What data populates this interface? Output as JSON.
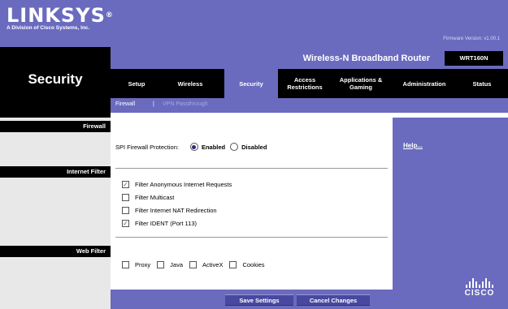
{
  "header": {
    "logo": "LINKSYS",
    "logo_mark": "®",
    "logo_sub": "A Division of Cisco Systems, Inc.",
    "firmware": "Firmware Version: v1.00.1"
  },
  "page_title": "Security",
  "product": {
    "name": "Wireless-N Broadband Router",
    "model": "WRT160N"
  },
  "nav": {
    "tabs": [
      {
        "label": "Setup"
      },
      {
        "label": "Wireless"
      },
      {
        "label": "Security",
        "active": true
      },
      {
        "label": "Access\nRestrictions"
      },
      {
        "label": "Applications &\nGaming"
      },
      {
        "label": "Administration"
      },
      {
        "label": "Status"
      }
    ],
    "subtabs": [
      {
        "label": "Firewall",
        "active": true
      },
      {
        "label": "|"
      },
      {
        "label": "VPN Passthrough"
      }
    ]
  },
  "sections": {
    "firewall": "Firewall",
    "internet_filter": "Internet Filter",
    "web_filter": "Web Filter"
  },
  "firewall": {
    "label": "SPI Firewall Protection:",
    "options": [
      {
        "label": "Enabled",
        "selected": true
      },
      {
        "label": "Disabled",
        "selected": false
      }
    ]
  },
  "internet_filter": {
    "items": [
      {
        "label": "Filter Anonymous Internet Requests",
        "checked": true
      },
      {
        "label": "Filter Multicast",
        "checked": false
      },
      {
        "label": "Filter Internet NAT Redirection",
        "checked": false
      },
      {
        "label": "Filter IDENT (Port 113)",
        "checked": true
      }
    ]
  },
  "web_filter": {
    "items": [
      {
        "label": "Proxy",
        "checked": false
      },
      {
        "label": "Java",
        "checked": false
      },
      {
        "label": "ActiveX",
        "checked": false
      },
      {
        "label": "Cookies",
        "checked": false
      }
    ]
  },
  "help": {
    "label": "Help..."
  },
  "buttons": {
    "save": "Save Settings",
    "cancel": "Cancel Changes"
  },
  "brand": {
    "cisco": "CISCO"
  },
  "colors": {
    "accent": "#6a6abf",
    "black": "#000000",
    "panel": "#e8e8e8"
  }
}
